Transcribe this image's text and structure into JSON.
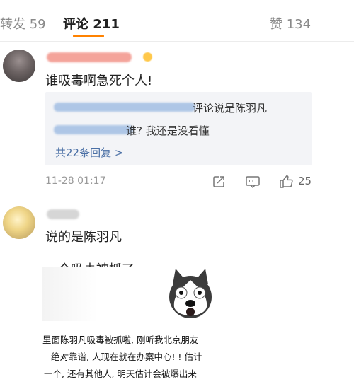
{
  "tabs": {
    "repost": "转发 59",
    "comments": "评论 211",
    "likes": "赞 134"
  },
  "comment1": {
    "text": "谁吸毒啊急死个人!",
    "reply_line1_text": "评论说是陈羽凡",
    "reply_line2_text": "谁? 我还是没看懂",
    "reply_more": "共22条回复 >",
    "time": "11-28 01:17",
    "like_count": "25"
  },
  "comment2": {
    "text_line1": "说的是陈羽凡",
    "text_line2": "一个吸毒被抓了",
    "meme_lines": [
      "里面陈羽凡吸毒被抓啦, 刚听我北京朋友",
      "绝对靠谱, 人现在就在办案中心! ! 估计",
      "一个, 还有其他人, 明天估计会被爆出来"
    ]
  },
  "icons": {
    "share": "share-icon",
    "reply": "comment-icon",
    "like": "thumbs-up-icon"
  },
  "colors": {
    "accent": "#ff8200",
    "link": "#4a6fa5",
    "reply_bg": "#f3f4f7"
  }
}
